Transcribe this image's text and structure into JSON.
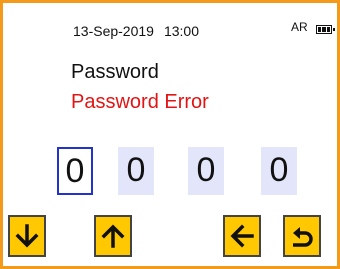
{
  "status": {
    "date": "13-Sep-2019",
    "time": "13:00",
    "mode": "AR",
    "battery_icon": "battery-icon"
  },
  "title": "Password",
  "error": "Password Error",
  "colors": {
    "frame": "#f39a1a",
    "error": "#e21414",
    "button": "#ffc800",
    "cursor": "#2233cc",
    "digit_bg": "#e3e5fb"
  },
  "pin": {
    "digits": [
      "0",
      "0",
      "0",
      "0"
    ],
    "active_index": 0
  },
  "buttons": [
    {
      "name": "down-button",
      "icon": "arrow-down-icon"
    },
    {
      "name": "up-button",
      "icon": "arrow-up-icon"
    },
    {
      "name": "back-button",
      "icon": "arrow-left-icon"
    },
    {
      "name": "return-button",
      "icon": "return-icon"
    }
  ]
}
